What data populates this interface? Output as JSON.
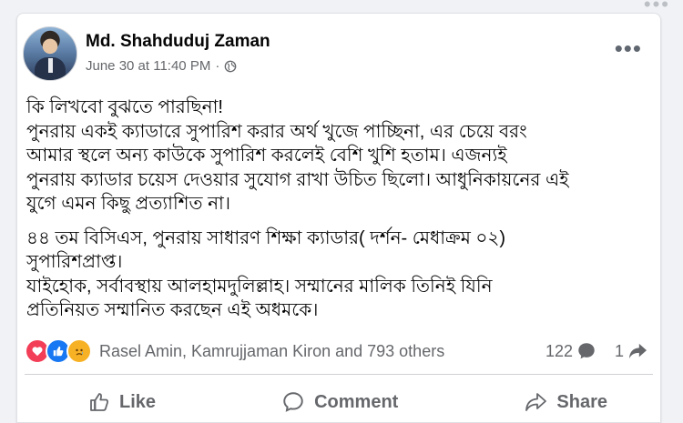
{
  "post": {
    "author": "Md. Shahduduj Zaman",
    "timestamp": "June 30 at 11:40 PM",
    "meta_separator": "·",
    "privacy_icon": "globe-icon",
    "paragraphs": [
      {
        "lines": [
          "কি লিখবো বুঝতে পারছিনা!",
          "পুনরায় একই ক্যাডারে সুপারিশ করার অর্থ খুজে পাচ্ছিনা, এর চেয়ে বরং",
          "আমার স্থলে অন্য কাউকে সুপারিশ করলেই বেশি খুশি হতাম। এজন্যই",
          "পুনরায় ক্যাডার চয়েস দেওয়ার সুযোগ রাখা উচিত ছিলো। আধুনিকায়নের এই",
          "যুগে এমন কিছু প্রত্যাশিত না।"
        ]
      },
      {
        "lines": [
          "৪৪ তম বিসিএস, পুনরায় সাধারণ শিক্ষা ক্যাডার( দর্শন- মেধাক্রম ০২)",
          "সুপারিশপ্রাপ্ত।",
          "যাইহোক, সর্বাবস্থায় আলহামদুলিল্লাহ। সম্মানের মালিক তিনিই যিনি",
          "প্রতিনিয়ত সম্মানিত করছেন এই অধমকে।"
        ]
      }
    ]
  },
  "reactions": {
    "icons": [
      "love",
      "like",
      "sad"
    ],
    "summary": "Rasel Amin, Kamrujjaman Kiron and 793 others",
    "comment_count": "122",
    "share_count": "1"
  },
  "actions": {
    "like": "Like",
    "comment": "Comment",
    "share": "Share"
  },
  "colors": {
    "background": "#f0f2f5",
    "card": "#ffffff",
    "secondary_text": "#65676b",
    "like_blue": "#1877f2",
    "love_red": "#f33e58",
    "sad_yellow": "#f7b125"
  }
}
